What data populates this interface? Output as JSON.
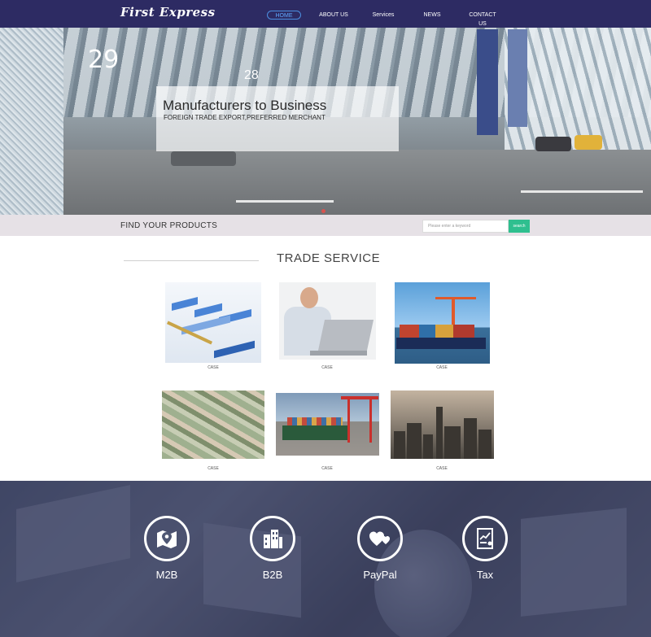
{
  "header": {
    "logo": "First Express",
    "nav": [
      {
        "label": "HOME",
        "active": true
      },
      {
        "label": "ABOUT US",
        "active": false
      },
      {
        "label": "Services",
        "active": false
      },
      {
        "label": "NEWS",
        "active": false
      },
      {
        "label": "CONTACT US",
        "active": false
      }
    ]
  },
  "hero": {
    "title": "Manufacturers to Business",
    "subtitle": "FOREIGN TRADE EXPORT,PREFERRED MERCHANT",
    "gate_left": "29",
    "gate_right": "28"
  },
  "search": {
    "label": "FIND YOUR PRODUCTS",
    "placeholder": "Please enter a keyword",
    "button": "search"
  },
  "trade_service": {
    "title": "TRADE SERVICE",
    "cases": [
      {
        "label": "CASE",
        "image": "charts-image"
      },
      {
        "label": "CASE",
        "image": "businessman-laptop-image"
      },
      {
        "label": "CASE",
        "image": "cargo-ship-image"
      },
      {
        "label": "CASE",
        "image": "money-image"
      },
      {
        "label": "CASE",
        "image": "port-crane-image"
      },
      {
        "label": "CASE",
        "image": "city-skyline-image"
      }
    ]
  },
  "features": [
    {
      "label": "M2B",
      "icon": "map-pin-icon"
    },
    {
      "label": "B2B",
      "icon": "buildings-icon"
    },
    {
      "label": "PayPal",
      "icon": "hearts-icon"
    },
    {
      "label": "Tax",
      "icon": "document-chart-icon"
    }
  ],
  "colors": {
    "nav_bg": "#2d2b63",
    "nav_active": "#5fa8ff",
    "search_button": "#2fbf8f",
    "search_strip": "#e6e1e6",
    "band_overlay": "#3a4260"
  }
}
